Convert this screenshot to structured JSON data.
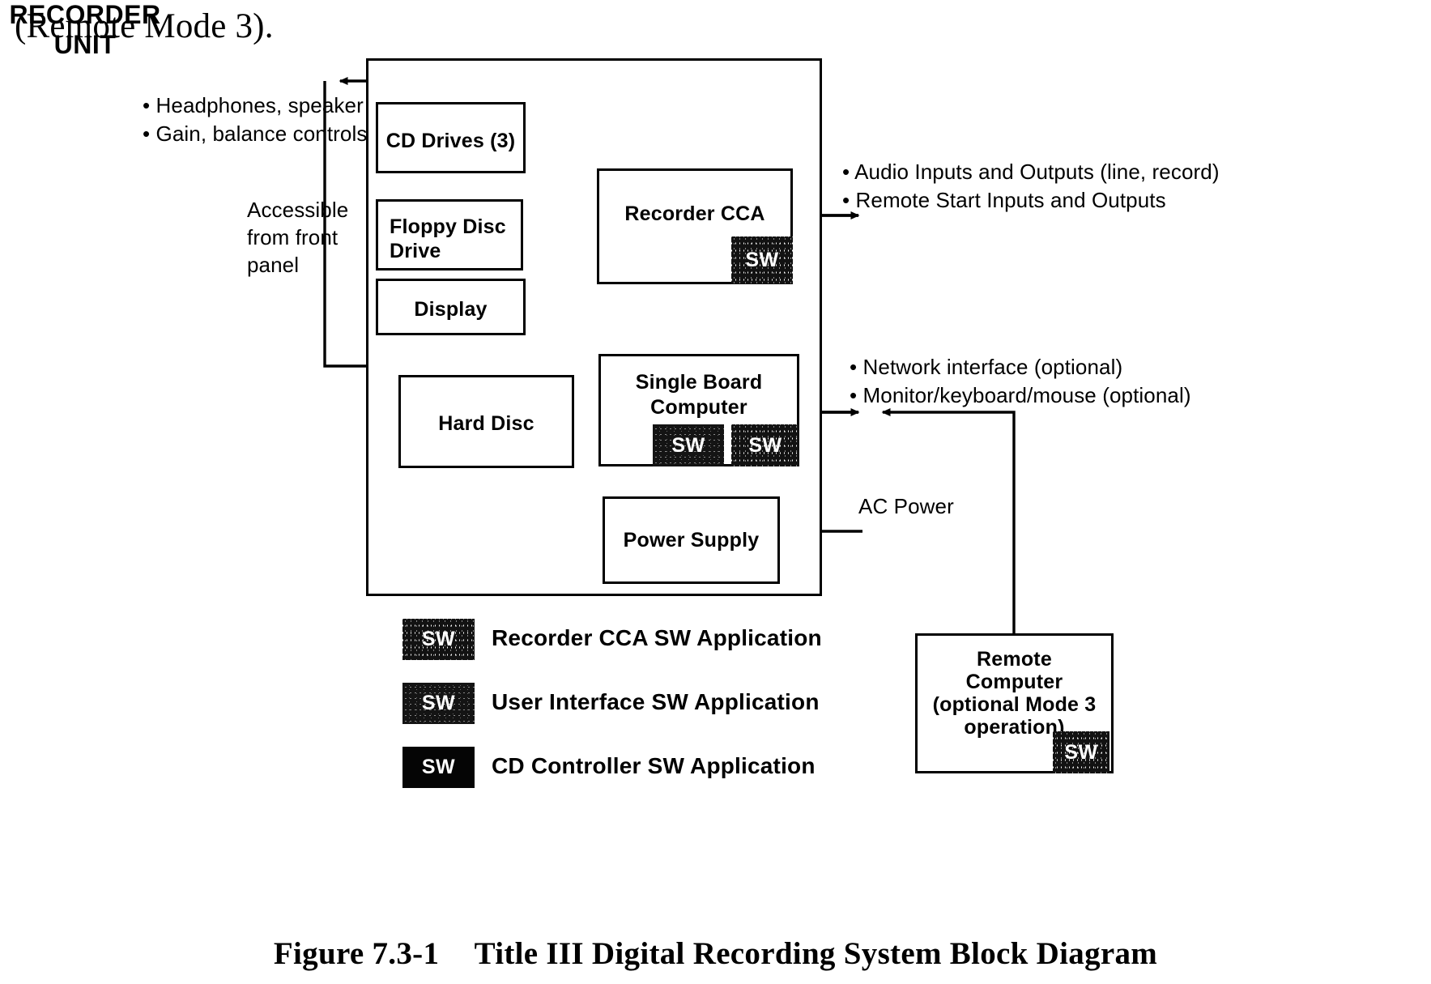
{
  "document": {
    "running_text": "(Remote Mode 3).",
    "caption_number": "Figure 7.3-1",
    "caption_title": "Title III Digital Recording System Block Diagram"
  },
  "enclosure": {
    "label_line1": "RECORDER",
    "label_line2": "UNIT"
  },
  "blocks": {
    "cd_drives": "CD Drives (3)",
    "floppy_drive_line1": "Floppy Disc",
    "floppy_drive_line2": "Drive",
    "display": "Display",
    "hard_disc": "Hard Disc",
    "recorder_cca": "Recorder CCA",
    "single_board_computer_line1": "Single Board",
    "single_board_computer_line2": "Computer",
    "power_supply": "Power Supply",
    "remote_computer_line1": "Remote",
    "remote_computer_line2": "Computer",
    "remote_computer_line3": "(optional Mode 3",
    "remote_computer_line4": "operation)"
  },
  "sw_badges": {
    "label": "SW",
    "recorder_cca_badge": "SW",
    "sbc_badge_ui": "SW",
    "sbc_badge_cd": "SW",
    "remote_badge": "SW"
  },
  "annotations": {
    "front_panel_io_line1": "• Headphones, speaker",
    "front_panel_io_line2": "• Gain, balance controls",
    "accessible_line1": "Accessible",
    "accessible_line2": "from front",
    "accessible_line3": "panel",
    "audio_io_line1": "• Audio Inputs and Outputs (line, record)",
    "audio_io_line2": "• Remote Start Inputs and Outputs",
    "network_line1": "• Network interface (optional)",
    "network_line2": "• Monitor/keyboard/mouse (optional)",
    "ac_power": "AC Power"
  },
  "legend": {
    "items": [
      {
        "swatch": "SW",
        "style": "speckA",
        "label": "Recorder CCA SW Application"
      },
      {
        "swatch": "SW",
        "style": "speckB",
        "label": "User Interface SW Application"
      },
      {
        "swatch": "SW",
        "style": "solid",
        "label": "CD Controller SW Application"
      }
    ]
  },
  "colors": {
    "ink": "#000000",
    "paper": "#ffffff",
    "badge_fill": "#111111"
  }
}
